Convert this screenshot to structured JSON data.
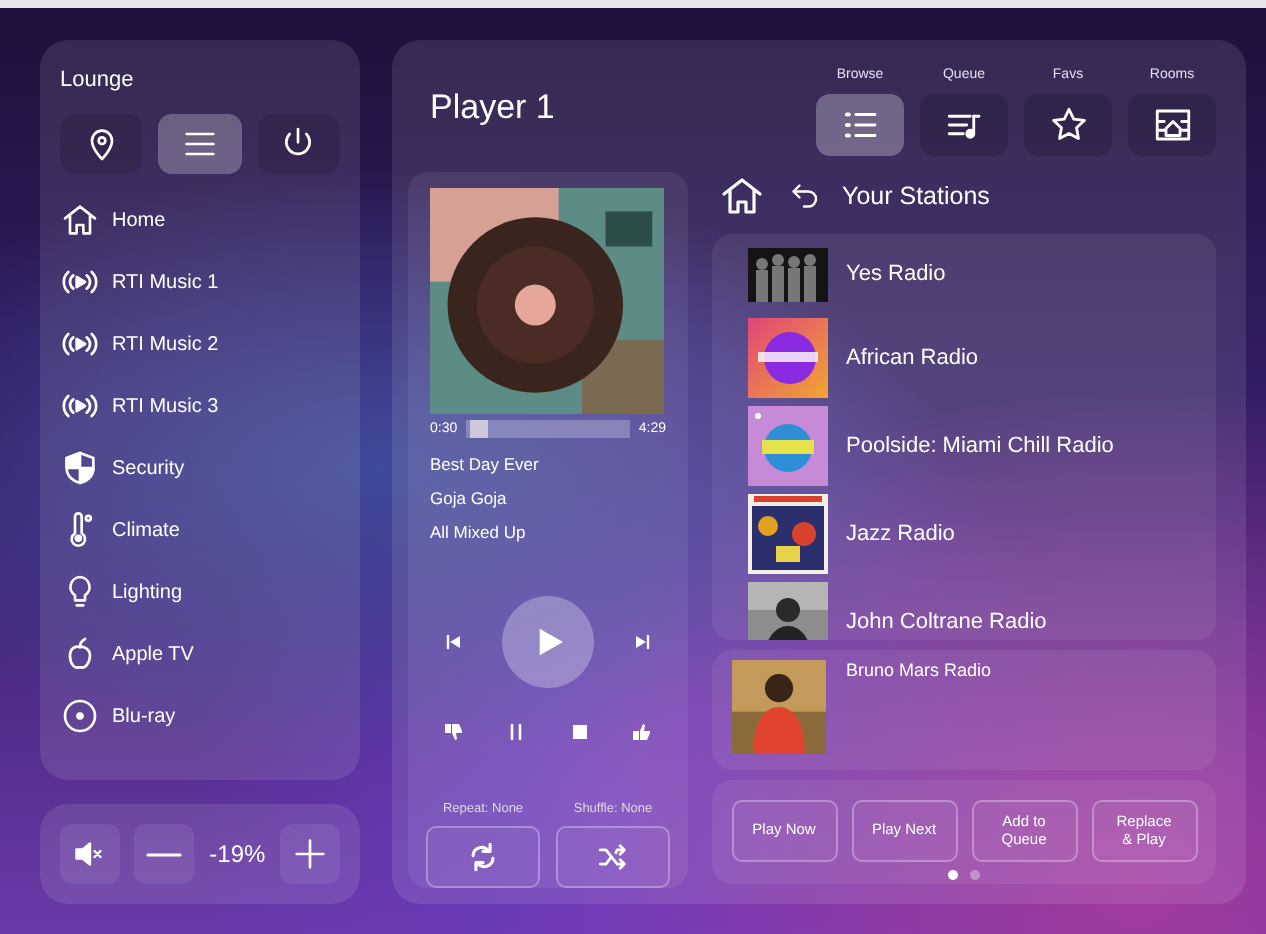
{
  "room": "Lounge",
  "room_buttons": [
    {
      "kind": "location",
      "selected": false
    },
    {
      "kind": "menu",
      "selected": true
    },
    {
      "kind": "power",
      "selected": false
    }
  ],
  "sources": [
    {
      "kind": "home",
      "label": "Home"
    },
    {
      "kind": "radio",
      "label": "RTI Music 1"
    },
    {
      "kind": "radio",
      "label": "RTI Music 2"
    },
    {
      "kind": "radio",
      "label": "RTI Music 3"
    },
    {
      "kind": "shield",
      "label": "Security"
    },
    {
      "kind": "thermometer",
      "label": "Climate"
    },
    {
      "kind": "bulb",
      "label": "Lighting"
    },
    {
      "kind": "apple",
      "label": "Apple TV"
    },
    {
      "kind": "disc",
      "label": "Blu-ray"
    }
  ],
  "volume": {
    "reading": "-19%"
  },
  "player": {
    "title": "Player 1"
  },
  "tabs": [
    {
      "kind": "list",
      "label": "Browse",
      "selected": true
    },
    {
      "kind": "queue",
      "label": "Queue",
      "selected": false
    },
    {
      "kind": "star",
      "label": "Favs",
      "selected": false
    },
    {
      "kind": "rooms",
      "label": "Rooms",
      "selected": false
    }
  ],
  "now_playing": {
    "elapsed": "0:30",
    "duration": "4:29",
    "level": 0.03,
    "song": "Best Day Ever",
    "artist": "Goja Goja",
    "album": "All Mixed Up",
    "repeat_label": "Repeat: None",
    "shuffle_label": "Shuffle: None"
  },
  "browser": {
    "heading": "Your Stations",
    "stations": [
      {
        "name": "Yes Radio"
      },
      {
        "name": "African Radio"
      },
      {
        "name": "Poolside: Miami Chill Radio"
      },
      {
        "name": "Jazz Radio"
      },
      {
        "name": "John Coltrane Radio"
      }
    ],
    "selected_station": {
      "name": "Bruno Mars Radio"
    },
    "actions": [
      "Play Now",
      "Play Next",
      "Add to\nQueue",
      "Replace\n& Play"
    ],
    "pages": [
      {
        "selected": true
      },
      {
        "selected": false
      }
    ]
  }
}
